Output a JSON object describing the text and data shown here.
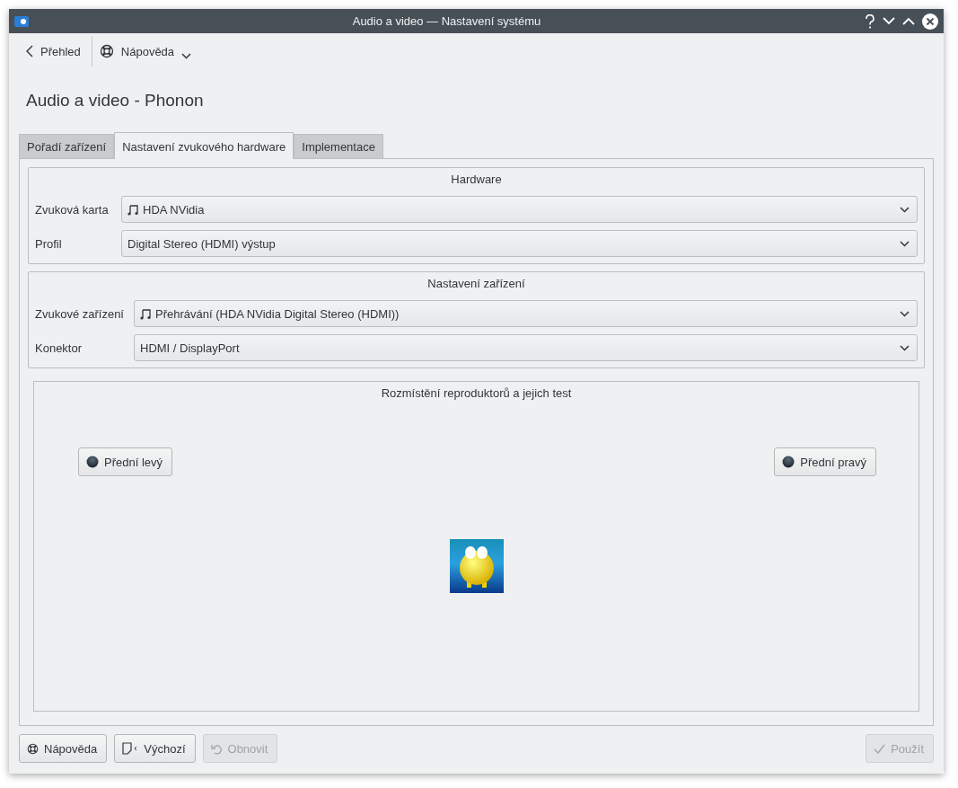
{
  "window": {
    "title": "Audio a video  — Nastavení systému"
  },
  "toolbar": {
    "back": "Přehled",
    "help": "Nápověda"
  },
  "page_title": "Audio a video - Phonon",
  "tabs": [
    {
      "label": "Pořadí zařízení",
      "selected": false
    },
    {
      "label": "Nastavení zvukového hardware",
      "selected": true
    },
    {
      "label": "Implementace",
      "selected": false
    }
  ],
  "groups": [
    {
      "title": "Hardware",
      "fields": [
        {
          "label": "Zvuková karta",
          "value": "HDA NVidia",
          "music_icon": true
        },
        {
          "label": "Profil",
          "value": "Digital Stereo (HDMI) výstup",
          "music_icon": false
        }
      ]
    },
    {
      "title": "Nastavení zařízení",
      "fields": [
        {
          "label": "Zvukové zařízení",
          "value": "Přehrávání (HDA NVidia Digital Stereo (HDMI))",
          "music_icon": true
        },
        {
          "label": "Konektor",
          "value": "HDMI / DisplayPort",
          "music_icon": false
        }
      ]
    }
  ],
  "speaker_test": {
    "title": "Rozmístění reproduktorů a jejich test",
    "speakers": [
      {
        "label": "Přední levý"
      },
      {
        "label": "Přední pravý"
      }
    ]
  },
  "footer": [
    {
      "label": "Nápověda",
      "kind": "help",
      "disabled": false
    },
    {
      "label": "Výchozí",
      "kind": "defaults",
      "disabled": false
    },
    {
      "label": "Obnovit",
      "kind": "reset",
      "disabled": true
    },
    {
      "label": "Použít",
      "kind": "apply",
      "disabled": true
    }
  ]
}
